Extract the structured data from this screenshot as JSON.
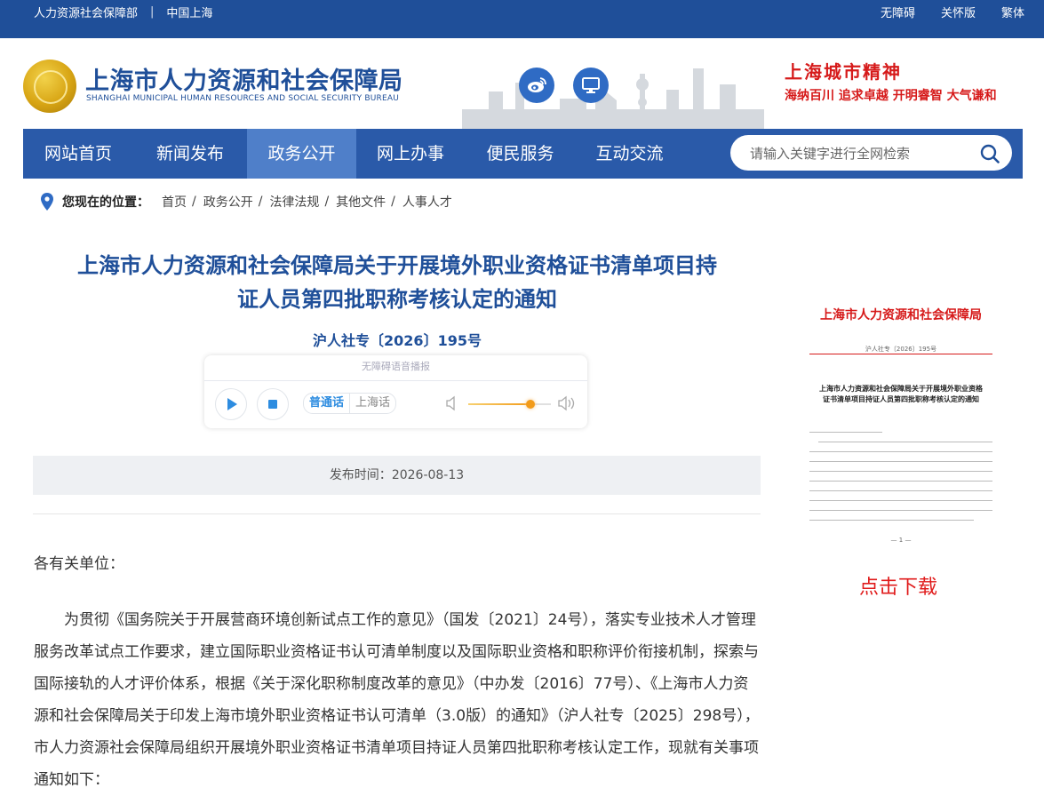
{
  "topbar": {
    "left_links": [
      "人力资源社会保障部",
      "中国上海"
    ],
    "right_links": [
      "无障碍",
      "关怀版",
      "繁体"
    ]
  },
  "header": {
    "title_cn": "上海市人力资源和社会保障局",
    "title_en": "SHANGHAI MUNICIPAL HUMAN RESOURCES AND SOCIAL SECURITY BUREAU",
    "slogan_title": "上海城市精神",
    "slogan_text": "海纳百川  追求卓越  开明睿智  大气谦和",
    "icons": [
      "weibo-icon",
      "monitor-icon"
    ]
  },
  "nav": {
    "items": [
      {
        "label": "网站首页"
      },
      {
        "label": "新闻发布"
      },
      {
        "label": "政务公开",
        "active": true
      },
      {
        "label": "网上办事"
      },
      {
        "label": "便民服务"
      },
      {
        "label": "互动交流"
      }
    ],
    "search_placeholder": "请输入关键字进行全网检索"
  },
  "breadcrumb": {
    "label": "您现在的位置：",
    "items": [
      "首页",
      "政务公开",
      "法律法规",
      "其他文件",
      "人事人才"
    ]
  },
  "article": {
    "title_line1": "上海市人力资源和社会保障局关于开展境外职业资格证书清单项目持",
    "title_line2": "证人员第四批职称考核认定的通知",
    "doc_no": "沪人社专〔2026〕195号",
    "player": {
      "caption": "无障碍语音播报",
      "lang_on": "普通话",
      "lang_off": "上海话",
      "volume": 0.75
    },
    "publish_label": "发布时间：",
    "publish_date": "2026-08-13",
    "salutation": "各有关单位：",
    "paragraph": "为贯彻《国务院关于开展营商环境创新试点工作的意见》（国发〔2021〕24号），落实专业技术人才管理服务改革试点工作要求，建立国际职业资格证书认可清单制度以及国际职业资格和职称评价衔接机制，探索与国际接轨的人才评价体系，根据《关于深化职称制度改革的意见》（中办发〔2016〕77号）、《上海市人力资源和社会保障局关于印发上海市境外职业资格证书认可清单（3.0版）的通知》（沪人社专〔2025〕298号），市人力资源社会保障局组织开展境外职业资格证书清单项目持证人员第四批职称考核认定工作，现就有关事项通知如下："
  },
  "sidebar": {
    "preview_header": "上海市人力资源和社会保障局",
    "preview_docno": "沪人社专〔2026〕195号",
    "preview_title": "上海市人力资源和社会保障局关于开展境外职业资格证书清单项目持证人员第四批职称考核认定的通知",
    "preview_page": "— 1 —",
    "download_label": "点击下载"
  },
  "colors": {
    "primary": "#1f4f99",
    "nav_bg": "#2a5aa9",
    "nav_active": "#4f7fc9",
    "accent_red": "#d61a1a"
  }
}
